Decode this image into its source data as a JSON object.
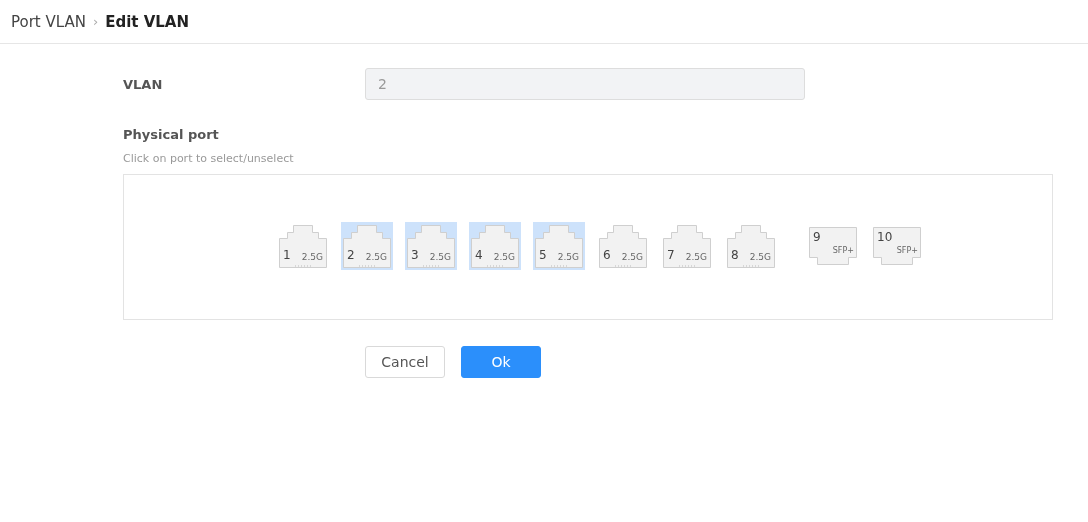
{
  "breadcrumb": {
    "parent": "Port VLAN",
    "separator": "›",
    "current": "Edit VLAN"
  },
  "vlan": {
    "label": "VLAN",
    "value": "2",
    "disabled": true
  },
  "physical_port": {
    "label": "Physical port",
    "hint": "Click on port to select/unselect"
  },
  "ports": [
    {
      "kind": "rj45",
      "number": "1",
      "speed": "2.5G",
      "selected": false
    },
    {
      "kind": "rj45",
      "number": "2",
      "speed": "2.5G",
      "selected": true
    },
    {
      "kind": "rj45",
      "number": "3",
      "speed": "2.5G",
      "selected": true
    },
    {
      "kind": "rj45",
      "number": "4",
      "speed": "2.5G",
      "selected": true
    },
    {
      "kind": "rj45",
      "number": "5",
      "speed": "2.5G",
      "selected": true
    },
    {
      "kind": "rj45",
      "number": "6",
      "speed": "2.5G",
      "selected": false
    },
    {
      "kind": "rj45",
      "number": "7",
      "speed": "2.5G",
      "selected": false
    },
    {
      "kind": "rj45",
      "number": "8",
      "speed": "2.5G",
      "selected": false
    },
    {
      "kind": "sfp",
      "number": "9",
      "speed": "SFP+",
      "selected": false
    },
    {
      "kind": "sfp",
      "number": "10",
      "speed": "SFP+",
      "selected": false
    }
  ],
  "buttons": {
    "cancel": "Cancel",
    "ok": "Ok"
  }
}
